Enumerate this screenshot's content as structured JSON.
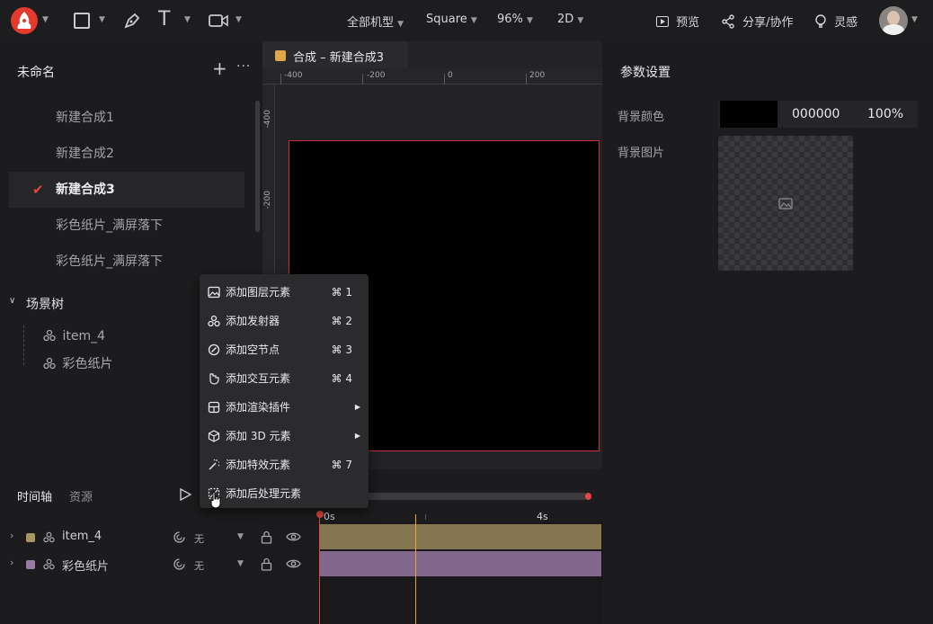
{
  "topbar": {
    "device": "全部机型",
    "shape": "Square",
    "zoom": "96%",
    "mode": "2D",
    "preview": "预览",
    "share": "分享/协作",
    "inspire": "灵感"
  },
  "project": {
    "title": "未命名"
  },
  "compositions": [
    "新建合成1",
    "新建合成2",
    "新建合成3",
    "彩色纸片_满屏落下",
    "彩色纸片_满屏落下"
  ],
  "scene_tree": {
    "title": "场景树",
    "items": [
      "item_4",
      "彩色纸片"
    ]
  },
  "canvas": {
    "tab_title": "合成 – 新建合成3",
    "tab_color": "#e0a64a",
    "ruler_h": [
      "-400",
      "-200",
      "0",
      "200"
    ],
    "ruler_v": [
      "-400",
      "-200"
    ]
  },
  "context_menu": [
    {
      "label": "添加图层元素",
      "shortcut": "⌘ 1",
      "icon": "image-icon"
    },
    {
      "label": "添加发射器",
      "shortcut": "⌘ 2",
      "icon": "emitter-icon"
    },
    {
      "label": "添加空节点",
      "shortcut": "⌘ 3",
      "icon": "null-node-icon"
    },
    {
      "label": "添加交互元素",
      "shortcut": "⌘ 4",
      "icon": "interact-icon"
    },
    {
      "label": "添加渲染插件",
      "shortcut": "",
      "icon": "plugin-icon",
      "submenu": true
    },
    {
      "label": "添加 3D 元素",
      "shortcut": "",
      "icon": "cube-icon",
      "submenu": true
    },
    {
      "label": "添加特效元素",
      "shortcut": "⌘ 7",
      "icon": "magic-wand-icon"
    },
    {
      "label": "添加后处理元素",
      "shortcut": "",
      "icon": "post-process-icon"
    }
  ],
  "params": {
    "title": "参数设置",
    "bg_color_label": "背景颜色",
    "bg_color_hex": "000000",
    "bg_color_opacity": "100%",
    "bg_image_label": "背景图片"
  },
  "timeline": {
    "tab_timeline": "时间轴",
    "tab_assets": "资源",
    "time_start": "0s",
    "time_mark": "4s",
    "tracks": [
      {
        "name": "item_4",
        "mode": "无",
        "color": "#a89563"
      },
      {
        "name": "彩色纸片",
        "mode": "无",
        "color": "#9a7ba7"
      }
    ]
  }
}
